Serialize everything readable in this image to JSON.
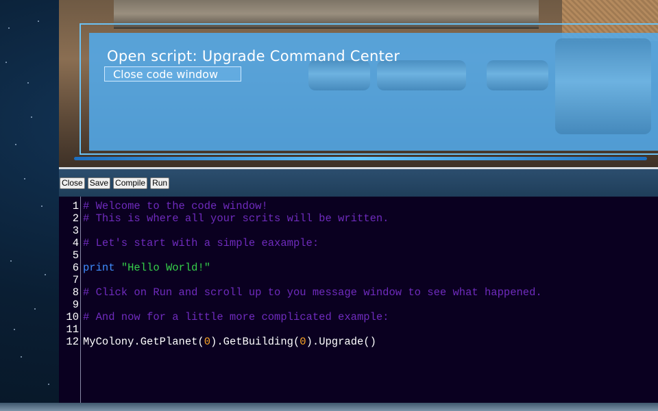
{
  "panel": {
    "title": "Open script: Upgrade Command Center",
    "close_link": "Close code window"
  },
  "toolbar": {
    "close_label": "Close",
    "save_label": "Save",
    "compile_label": "Compile",
    "run_label": "Run"
  },
  "editor": {
    "lines": [
      {
        "n": "1",
        "tokens": [
          {
            "t": "comment",
            "v": "# Welcome to the code window!"
          }
        ]
      },
      {
        "n": "2",
        "tokens": [
          {
            "t": "comment",
            "v": "# This is where all your scrits will be written."
          }
        ]
      },
      {
        "n": "3",
        "tokens": []
      },
      {
        "n": "4",
        "tokens": [
          {
            "t": "comment",
            "v": "# Let's start with a simple eaxample:"
          }
        ]
      },
      {
        "n": "5",
        "tokens": []
      },
      {
        "n": "6",
        "tokens": [
          {
            "t": "kw",
            "v": "print"
          },
          {
            "t": "plain",
            "v": " "
          },
          {
            "t": "str",
            "v": "\"Hello World!\""
          }
        ]
      },
      {
        "n": "7",
        "tokens": []
      },
      {
        "n": "8",
        "tokens": [
          {
            "t": "comment",
            "v": "# Click on Run and scroll up to you message window to see what happened."
          }
        ]
      },
      {
        "n": "9",
        "tokens": []
      },
      {
        "n": "10",
        "tokens": [
          {
            "t": "comment",
            "v": "# And now for a little more complicated example:"
          }
        ]
      },
      {
        "n": "11",
        "tokens": []
      },
      {
        "n": "12",
        "tokens": [
          {
            "t": "plain",
            "v": "MyColony.GetPlanet("
          },
          {
            "t": "num",
            "v": "0"
          },
          {
            "t": "plain",
            "v": ").GetBuilding("
          },
          {
            "t": "num",
            "v": "0"
          },
          {
            "t": "plain",
            "v": ").Upgrade()"
          }
        ]
      }
    ]
  },
  "colors": {
    "comment": "#6f2bbd",
    "keyword": "#3f8cff",
    "string": "#36d04a",
    "number": "#ffa726",
    "editor_bg": "#0a0020",
    "panel_bg": "#52aaeb"
  }
}
